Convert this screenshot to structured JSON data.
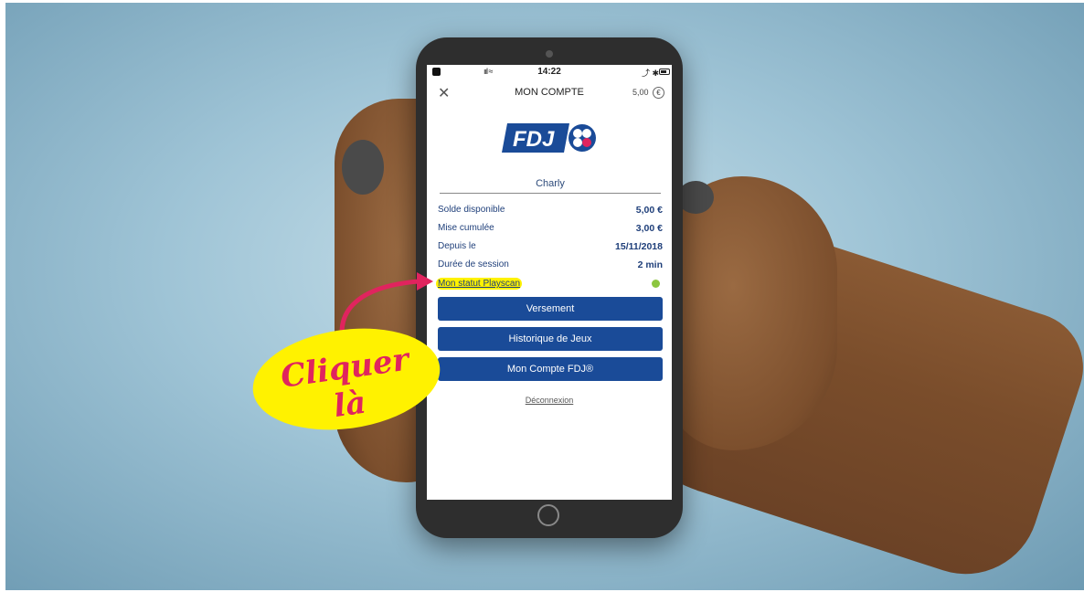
{
  "status_bar": {
    "time": "14:22",
    "signal": "ııl ≈",
    "right_icons": "⤴ ✱"
  },
  "header": {
    "close_symbol": "✕",
    "title": "MON COMPTE",
    "balance": "5,00",
    "currency_symbol": "€"
  },
  "logo": {
    "text": "FDJ"
  },
  "account": {
    "username": "Charly",
    "rows": [
      {
        "label": "Solde disponible",
        "value": "5,00 €"
      },
      {
        "label": "Mise cumulée",
        "value": "3,00 €"
      },
      {
        "label": "Depuis le",
        "value": "15/11/2018"
      },
      {
        "label": "Durée de session",
        "value": "2 min"
      }
    ],
    "playscan_label": "Mon statut Playscan",
    "playscan_status_color": "#8cc63f"
  },
  "actions": {
    "versement": "Versement",
    "historique": "Historique de Jeux",
    "mon_compte_fdj": "Mon Compte FDJ®",
    "logout": "Déconnexion"
  },
  "annotation": {
    "text": "Cliquer là"
  },
  "colors": {
    "primary_blue": "#1a4b98",
    "highlight_yellow": "#fff200",
    "annotation_pink": "#e0245e"
  }
}
